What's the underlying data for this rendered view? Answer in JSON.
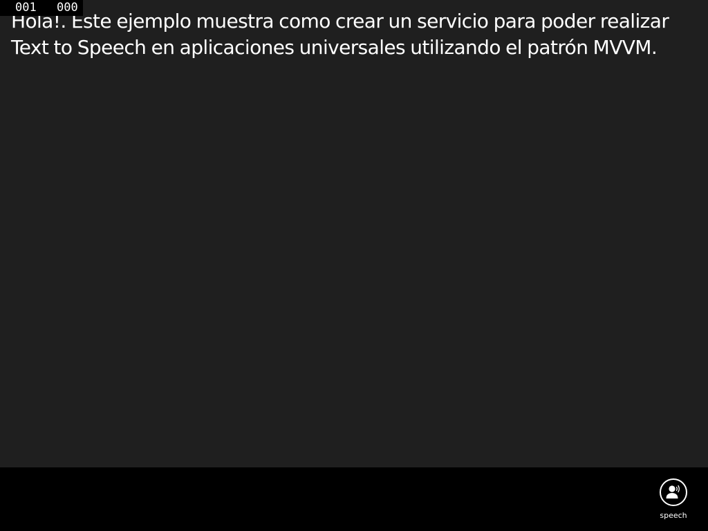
{
  "frame_counter": {
    "left_value": "001",
    "right_value": "000"
  },
  "main": {
    "description": "Hola!. Este ejemplo muestra como crear un servicio para poder realizar Text to Speech en aplicaciones universales utilizando el patrón MVVM."
  },
  "app_bar": {
    "buttons": [
      {
        "label": "speech",
        "icon": "speech-icon"
      }
    ]
  },
  "colors": {
    "background": "#1f1f1f",
    "app_bar": "#000000",
    "foreground": "#ffffff"
  }
}
